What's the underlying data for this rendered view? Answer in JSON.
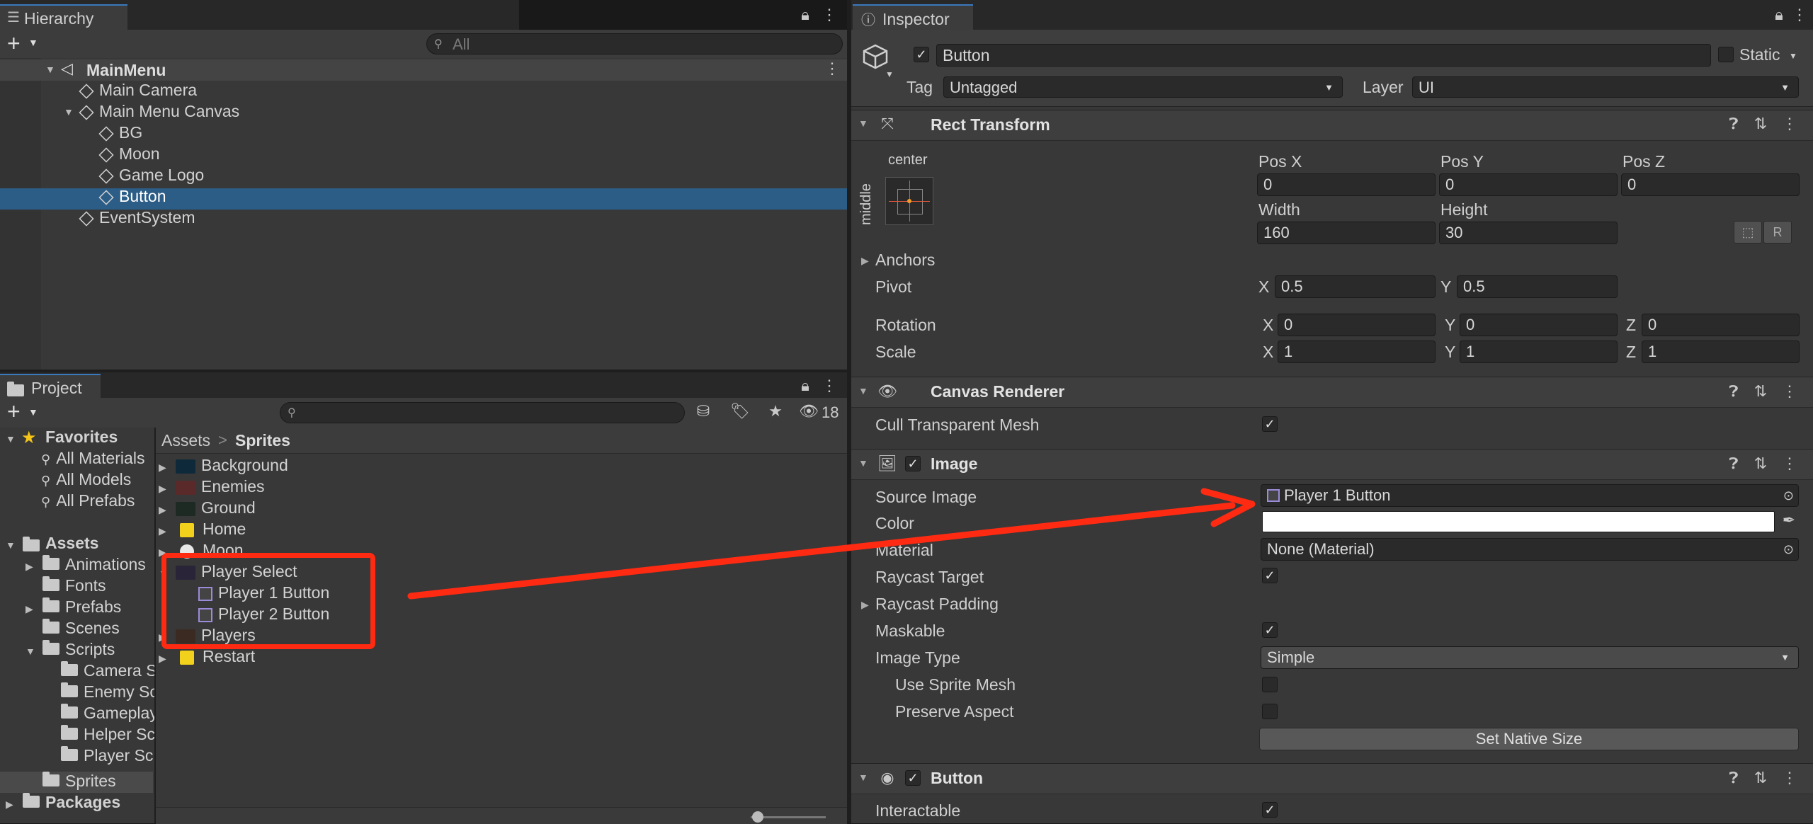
{
  "hierarchy": {
    "tab_label": "Hierarchy",
    "search_placeholder": "All",
    "add_label": "+",
    "items": [
      {
        "label": "MainMenu"
      },
      {
        "label": "Main Camera"
      },
      {
        "label": "Main Menu Canvas"
      },
      {
        "label": "BG"
      },
      {
        "label": "Moon"
      },
      {
        "label": "Game Logo"
      },
      {
        "label": "Button"
      },
      {
        "label": "EventSystem"
      }
    ]
  },
  "project": {
    "tab_label": "Project",
    "add_label": "+",
    "hidden_count": "18",
    "favorites": {
      "label": "Favorites",
      "items": [
        "All Materials",
        "All Models",
        "All Prefabs"
      ]
    },
    "assets_tree": {
      "label": "Assets",
      "items": [
        "Animations",
        "Fonts",
        "Prefabs",
        "Scenes",
        "Scripts"
      ],
      "scripts_children": [
        "Camera S",
        "Enemy Sc",
        "Gameplay",
        "Helper Sc",
        "Player Sc"
      ],
      "sprites": "Sprites",
      "packages": "Packages"
    },
    "breadcrumb": {
      "root": "Assets",
      "separator": ">",
      "current": "Sprites"
    },
    "files": [
      "Background",
      "Enemies",
      "Ground",
      "Home",
      "Moon",
      "Player Select",
      "Player 1 Button",
      "Player 2 Button",
      "Players",
      "Restart"
    ]
  },
  "inspector": {
    "tab_label": "Inspector",
    "object_name": "Button",
    "static_label": "Static",
    "tag_label": "Tag",
    "tag_value": "Untagged",
    "layer_label": "Layer",
    "layer_value": "UI",
    "rect_transform": {
      "title": "Rect Transform",
      "anchor_h": "center",
      "anchor_v": "middle",
      "pos_x_label": "Pos X",
      "pos_x": "0",
      "pos_y_label": "Pos Y",
      "pos_y": "0",
      "pos_z_label": "Pos Z",
      "pos_z": "0",
      "width_label": "Width",
      "width": "160",
      "height_label": "Height",
      "height": "30",
      "r_button": "R",
      "anchors_label": "Anchors",
      "pivot_label": "Pivot",
      "pivot_x_label": "X",
      "pivot_x": "0.5",
      "pivot_y_label": "Y",
      "pivot_y": "0.5",
      "rotation_label": "Rotation",
      "rot_x": "0",
      "rot_y": "0",
      "rot_z": "0",
      "scale_label": "Scale",
      "scale_x": "1",
      "scale_y": "1",
      "scale_z": "1",
      "x_label": "X",
      "y_label": "Y",
      "z_label": "Z"
    },
    "canvas_renderer": {
      "title": "Canvas Renderer",
      "cull_label": "Cull Transparent Mesh"
    },
    "image": {
      "title": "Image",
      "source_image_label": "Source Image",
      "source_image_value": "Player 1 Button",
      "color_label": "Color",
      "color_value": "#ffffff",
      "material_label": "Material",
      "material_value": "None (Material)",
      "raycast_target_label": "Raycast Target",
      "raycast_padding_label": "Raycast Padding",
      "maskable_label": "Maskable",
      "image_type_label": "Image Type",
      "image_type_value": "Simple",
      "use_sprite_mesh_label": "Use Sprite Mesh",
      "preserve_aspect_label": "Preserve Aspect",
      "set_native_size_label": "Set Native Size"
    },
    "button": {
      "title": "Button",
      "interactable_label": "Interactable"
    }
  },
  "colors": {
    "selection": "#2c5d87",
    "annotation": "#ff2a12",
    "accent_tab": "#3a79bb"
  }
}
